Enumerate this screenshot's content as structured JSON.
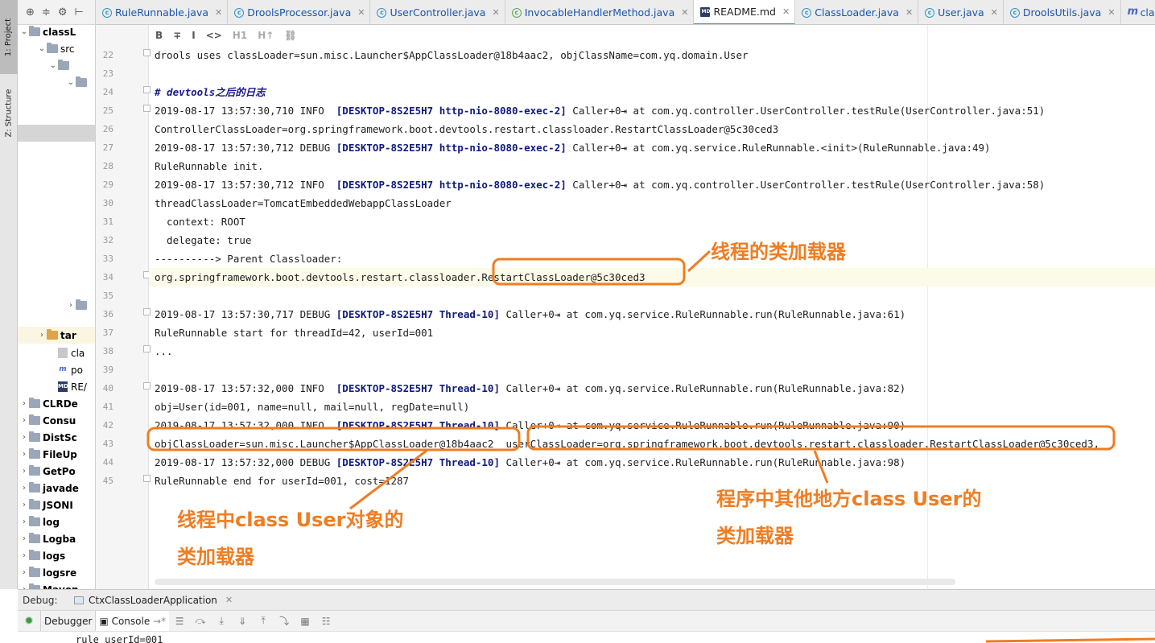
{
  "tool_strip": {
    "project_label": "1: Project",
    "structure_label": "Z: Structure"
  },
  "project_tree": {
    "rows": [
      {
        "label": "classL",
        "arrow": "⌄"
      },
      {
        "label": "src",
        "arrow": "⌄"
      },
      {
        "label": "",
        "arrow": "⌄"
      },
      {
        "label": "",
        "arrow": "⌄"
      },
      {
        "label": "",
        "arrow": "›"
      },
      {
        "label": "tar",
        "arrow": "›"
      },
      {
        "label": "cla",
        "arrow": ""
      },
      {
        "label": "po",
        "arrow": ""
      },
      {
        "label": "RE/",
        "arrow": ""
      },
      {
        "label": "CLRDe",
        "arrow": "›"
      },
      {
        "label": "Consu",
        "arrow": "›"
      },
      {
        "label": "DistSc",
        "arrow": "›"
      },
      {
        "label": "FileUp",
        "arrow": "›"
      },
      {
        "label": "GetPo",
        "arrow": "›"
      },
      {
        "label": "javade",
        "arrow": "›"
      },
      {
        "label": "JSONI",
        "arrow": "›"
      },
      {
        "label": "log",
        "arrow": "›"
      },
      {
        "label": "Logba",
        "arrow": "›"
      },
      {
        "label": "logs",
        "arrow": "›"
      },
      {
        "label": "logsre",
        "arrow": "›"
      },
      {
        "label": "Maven",
        "arrow": "›"
      }
    ]
  },
  "tabs": [
    {
      "label": "RuleRunnable.java",
      "icon": "c"
    },
    {
      "label": "DroolsProcessor.java",
      "icon": "c"
    },
    {
      "label": "UserController.java",
      "icon": "c"
    },
    {
      "label": "InvocableHandlerMethod.java",
      "icon": "i"
    },
    {
      "label": "README.md",
      "icon": "md"
    },
    {
      "label": "ClassLoader.java",
      "icon": "c"
    },
    {
      "label": "User.java",
      "icon": "c"
    },
    {
      "label": "DroolsUtils.java",
      "icon": "c"
    },
    {
      "label": "classLoader",
      "icon": "m"
    }
  ],
  "md_toolbar": [
    "B",
    "∓",
    "I",
    "<>",
    "H1",
    "H↑",
    "⛓"
  ],
  "editor": {
    "lines": [
      {
        "n": "22",
        "pre": "drools uses classLoader=sun.misc.Launcher$AppClassLoader@18b4aac2, objClassName=com.yq.domain.User",
        "bold": "",
        "post": ""
      },
      {
        "n": "23",
        "pre": "",
        "bold": "",
        "post": ""
      },
      {
        "n": "24",
        "pre": "",
        "bold": "",
        "post": "",
        "heading": "# devtools之后的日志"
      },
      {
        "n": "25",
        "pre": "2019-08-17 13:57:30,710 INFO  ",
        "bold": "[DESKTOP-8S2E5H7 http-nio-8080-exec-2]",
        "post": " Caller+0⇥ at com.yq.controller.UserController.testRule(UserController.java:51)"
      },
      {
        "n": "26",
        "pre": "ControllerClassLoader=org.springframework.boot.devtools.restart.classloader.RestartClassLoader@5c30ced3",
        "bold": "",
        "post": ""
      },
      {
        "n": "27",
        "pre": "2019-08-17 13:57:30,712 DEBUG ",
        "bold": "[DESKTOP-8S2E5H7 http-nio-8080-exec-2]",
        "post": " Caller+0⇥ at com.yq.service.RuleRunnable.<init>(RuleRunnable.java:49)"
      },
      {
        "n": "28",
        "pre": "RuleRunnable init.",
        "bold": "",
        "post": ""
      },
      {
        "n": "29",
        "pre": "2019-08-17 13:57:30,712 INFO  ",
        "bold": "[DESKTOP-8S2E5H7 http-nio-8080-exec-2]",
        "post": " Caller+0⇥ at com.yq.controller.UserController.testRule(UserController.java:58)"
      },
      {
        "n": "30",
        "pre": "threadClassLoader=TomcatEmbeddedWebappClassLoader",
        "bold": "",
        "post": ""
      },
      {
        "n": "31",
        "pre": "  context: ROOT",
        "bold": "",
        "post": ""
      },
      {
        "n": "32",
        "pre": "  delegate: true",
        "bold": "",
        "post": ""
      },
      {
        "n": "33",
        "pre": "----------> Parent Classloader:",
        "bold": "",
        "post": ""
      },
      {
        "n": "34",
        "pre": "org.springframework.boot.devtools.restart.classloader.RestartClassLoader@5c30ced3",
        "bold": "",
        "post": "",
        "hl": true
      },
      {
        "n": "35",
        "pre": "",
        "bold": "",
        "post": ""
      },
      {
        "n": "36",
        "pre": "2019-08-17 13:57:30,717 DEBUG ",
        "bold": "[DESKTOP-8S2E5H7 Thread-10]",
        "post": " Caller+0⇥ at com.yq.service.RuleRunnable.run(RuleRunnable.java:61)"
      },
      {
        "n": "37",
        "pre": "RuleRunnable start for threadId=42, userId=001",
        "bold": "",
        "post": ""
      },
      {
        "n": "38",
        "pre": "...",
        "bold": "",
        "post": ""
      },
      {
        "n": "39",
        "pre": "",
        "bold": "",
        "post": ""
      },
      {
        "n": "40",
        "pre": "2019-08-17 13:57:32,000 INFO  ",
        "bold": "[DESKTOP-8S2E5H7 Thread-10]",
        "post": " Caller+0⇥ at com.yq.service.RuleRunnable.run(RuleRunnable.java:82)"
      },
      {
        "n": "41",
        "pre": "obj=User(id=001, name=null, mail=null, regDate=null)",
        "bold": "",
        "post": ""
      },
      {
        "n": "42",
        "pre": "2019-08-17 13:57:32,000 INFO  ",
        "bold": "[DESKTOP-8S2E5H7 Thread-10]",
        "post": " Caller+0⇥ at com.yq.service.RuleRunnable.run(RuleRunnable.java:90)"
      },
      {
        "n": "43",
        "pre": "objClassLoader=sun.misc.Launcher$AppClassLoader@18b4aac2  userClassLoader=org.springframework.boot.devtools.restart.classloader.RestartClassLoader@5c30ced3,",
        "bold": "",
        "post": ""
      },
      {
        "n": "44",
        "pre": "2019-08-17 13:57:32,000 DEBUG ",
        "bold": "[DESKTOP-8S2E5H7 Thread-10]",
        "post": " Caller+0⇥ at com.yq.service.RuleRunnable.run(RuleRunnable.java:98)"
      },
      {
        "n": "45",
        "pre": "RuleRunnable end for userId=001, cost=1287",
        "bold": "",
        "post": ""
      }
    ]
  },
  "annotations": {
    "color": "#ef7d22",
    "thread_loader": "线程的类加载器",
    "obj_loader_line1": "线程中class User对象的",
    "obj_loader_line2": "类加载器",
    "user_loader_line1": "程序中其他地方class User的",
    "user_loader_line2": "类加载器"
  },
  "debug": {
    "title": "Debug:",
    "run_config": "CtxClassLoaderApplication",
    "debugger_tab": "Debugger",
    "console_tab": "Console",
    "console_output": "rule userId=001"
  }
}
